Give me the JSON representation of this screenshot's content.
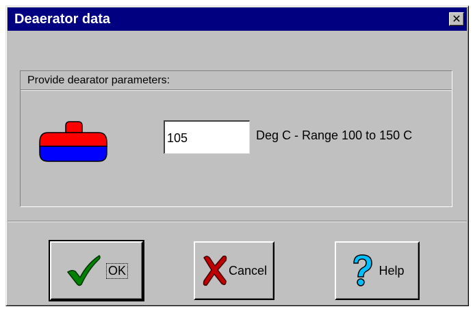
{
  "window": {
    "title": "Deaerator data",
    "close_glyph": "✕",
    "title_bar_color": "#000080"
  },
  "group": {
    "label": "Provide dearator parameters:",
    "icon": "deaerator-tank-icon",
    "icon_colors": {
      "top": "#ff0000",
      "bottom": "#0000ff"
    }
  },
  "temperature": {
    "value": "105",
    "unit_range_text": "Deg C - Range 100 to 150 C"
  },
  "buttons": {
    "ok": {
      "label": "OK",
      "icon": "checkmark-icon",
      "icon_color": "#008000"
    },
    "cancel": {
      "label": "Cancel",
      "icon": "red-x-icon",
      "icon_color": "#c00000"
    },
    "help": {
      "label": "Help",
      "icon": "question-mark-icon",
      "icon_color": "#00bfff"
    }
  }
}
